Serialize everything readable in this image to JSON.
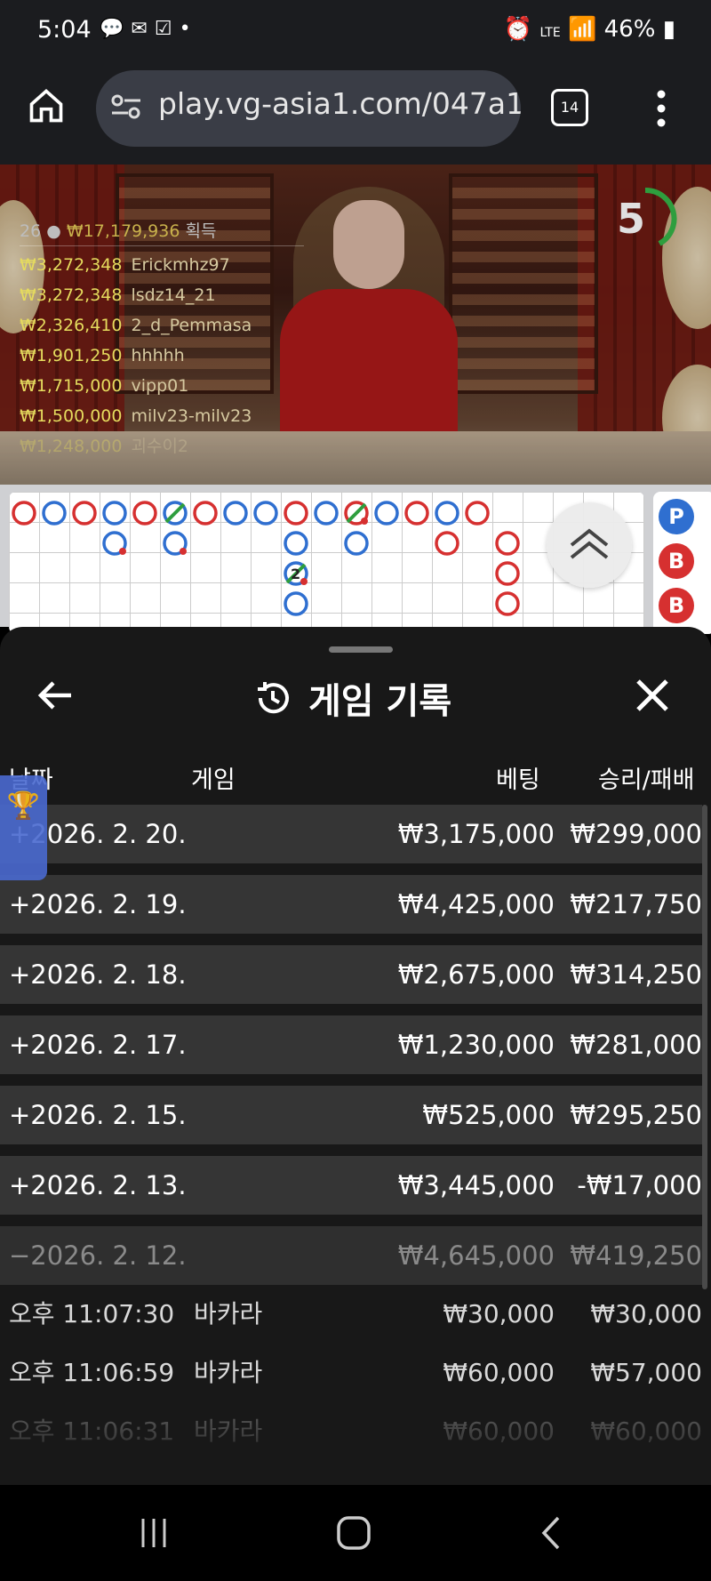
{
  "status_bar": {
    "time": "5:04",
    "battery": "46%",
    "network": "LTE"
  },
  "browser": {
    "url": "play.vg-asia1.com/047a1",
    "tab_count": "14"
  },
  "live_game": {
    "winners_header": {
      "count": "26",
      "amount": "₩17,179,936",
      "suffix": "획득"
    },
    "winners": [
      {
        "amount": "₩3,272,348",
        "name": "Erickmhz97"
      },
      {
        "amount": "₩3,272,348",
        "name": "lsdz14_21"
      },
      {
        "amount": "₩2,326,410",
        "name": "2_d_Pemmasa"
      },
      {
        "amount": "₩1,901,250",
        "name": "hhhhh"
      },
      {
        "amount": "₩1,715,000",
        "name": "vipp01"
      },
      {
        "amount": "₩1,500,000",
        "name": "milv23-milv23"
      },
      {
        "amount": "₩1,248,000",
        "name": "괴수이2"
      }
    ],
    "timer": "5"
  },
  "roadmap": {
    "side_labels": [
      "P",
      "B",
      "B"
    ],
    "tie_number": "2"
  },
  "history": {
    "title": "게임 기록",
    "columns": {
      "date": "날짜",
      "game": "게임",
      "bet": "베팅",
      "result": "승리/패배"
    },
    "days": [
      {
        "date": "+2026. 2. 20.",
        "bet": "₩3,175,000",
        "result": "₩299,000"
      },
      {
        "date": "+2026. 2. 19.",
        "bet": "₩4,425,000",
        "result": "₩217,750"
      },
      {
        "date": "+2026. 2. 18.",
        "bet": "₩2,675,000",
        "result": "₩314,250"
      },
      {
        "date": "+2026. 2. 17.",
        "bet": "₩1,230,000",
        "result": "₩281,000"
      },
      {
        "date": "+2026. 2. 15.",
        "bet": "₩525,000",
        "result": "₩295,250"
      },
      {
        "date": "+2026. 2. 13.",
        "bet": "₩3,445,000",
        "result": "-₩17,000"
      },
      {
        "date": "−2026. 2. 12.",
        "bet": "₩4,645,000",
        "result": "₩419,250"
      }
    ],
    "games": [
      {
        "time": "오후 11:07:30",
        "game": "바카라",
        "bet": "₩30,000",
        "result": "₩30,000"
      },
      {
        "time": "오후 11:06:59",
        "game": "바카라",
        "bet": "₩60,000",
        "result": "₩57,000"
      },
      {
        "time": "오후 11:06:31",
        "game": "바카라",
        "bet": "₩60,000",
        "result": "₩60,000"
      }
    ]
  }
}
